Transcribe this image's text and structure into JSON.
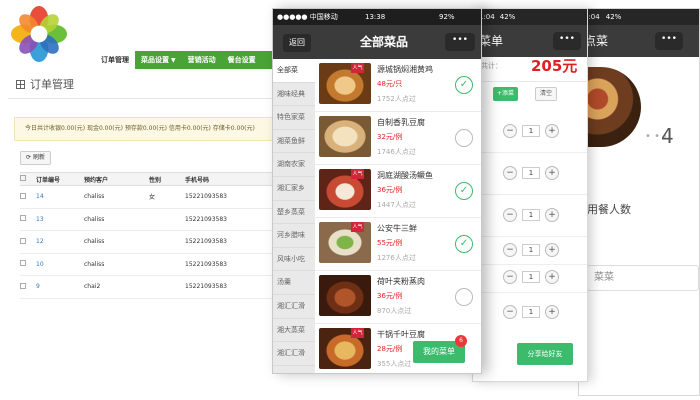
{
  "admin": {
    "nav": [
      {
        "label": "订单管理",
        "active": true,
        "dropdown": false
      },
      {
        "label": "菜品设置",
        "active": false,
        "dropdown": true
      },
      {
        "label": "营销活动",
        "active": false,
        "dropdown": false
      },
      {
        "label": "餐台设置",
        "active": false,
        "dropdown": false
      }
    ],
    "section_title": "订单管理",
    "summary": "今日共计收银0.00(元) 现金0.00(元) 预存款0.00(元) 信用卡0.00(元) 存储卡0.00(元)",
    "refresh_label": "刷新",
    "table": {
      "headers": [
        "订单编号",
        "预约客户",
        "性别",
        "手机号码"
      ],
      "rows": [
        {
          "id": "14",
          "customer": "chaliss",
          "gender": "女",
          "phone": "15221093583"
        },
        {
          "id": "13",
          "customer": "chaliss",
          "gender": "",
          "phone": "15221093583"
        },
        {
          "id": "12",
          "customer": "chaliss",
          "gender": "",
          "phone": "15221093583"
        },
        {
          "id": "10",
          "customer": "chaliss",
          "gender": "",
          "phone": "15221093583"
        },
        {
          "id": "9",
          "customer": "chai2",
          "gender": "",
          "phone": "15221093583"
        }
      ]
    }
  },
  "phone1": {
    "status": {
      "carrier": "●●●●● 中国移动",
      "time": "13:38",
      "battery": "92%"
    },
    "back_label": "返回",
    "title": "全部菜品",
    "more_label": "•••",
    "categories": [
      "全部菜",
      "湘味经典",
      "特色家菜",
      "湘菜鱼鲜",
      "湖南农家",
      "湘汇家乡",
      "楚乡蒸菜",
      "河乡腊味",
      "风味小吃",
      "汤羹",
      "湘汇汇滑",
      "湘大蒸菜",
      "湘汇汇滑",
      "特色饮"
    ],
    "tag_label": "人气",
    "dishes": [
      {
        "name": "源城锅焖湘黄鸡",
        "price": "48元/只",
        "orders": "1752人点过",
        "checked": true
      },
      {
        "name": "自制香乳豆腐",
        "price": "32元/例",
        "orders": "1746人点过",
        "checked": false
      },
      {
        "name": "洞庭湖酸汤鳜鱼",
        "price": "36元/例",
        "orders": "1447人点过",
        "checked": true
      },
      {
        "name": "公安牛三鲜",
        "price": "55元/例",
        "orders": "1276人点过",
        "checked": true
      },
      {
        "name": "荷叶夹粉蒸肉",
        "price": "36元/例",
        "orders": "870人点过",
        "checked": false
      },
      {
        "name": "干锅千叶豆腐",
        "price": "28元/例",
        "orders": "355人点过",
        "checked": false
      }
    ],
    "my_menu_label": "我的菜单",
    "badge": "6"
  },
  "phone2": {
    "status": {
      "time": "1:04",
      "battery": "42%"
    },
    "title": "菜单",
    "more_label": "•••",
    "total_label": "共计：",
    "total": "205元",
    "add_label": "+添菜",
    "clear_label": "清空",
    "quantities": [
      "1",
      "1",
      "1",
      "1",
      "1",
      "1"
    ],
    "share_label": "分享给好友"
  },
  "phone3": {
    "status": {
      "time": "1:04",
      "battery": "42%"
    },
    "title": "点菜",
    "more_label": "•••",
    "step_number": "4",
    "diners_label": "用餐人数",
    "input_value": "菜菜"
  },
  "colors": {
    "brand_green": "#4aa336",
    "accent_green": "#3cbb6c",
    "price_red": "#e02020",
    "header_dark": "#3b3b3b"
  }
}
